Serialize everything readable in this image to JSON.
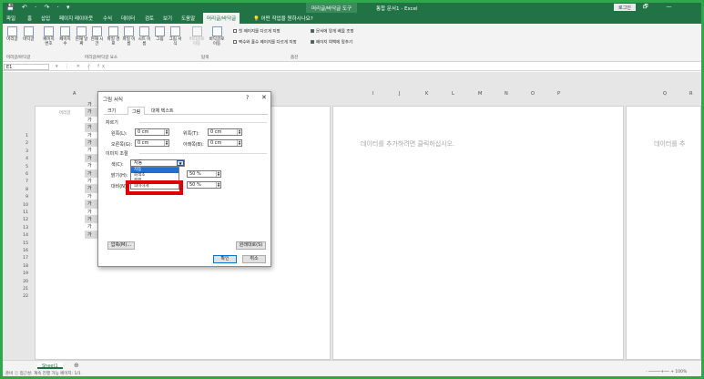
{
  "titlebar": {
    "quick_access": "💾 ↶ · ↷ · ▾",
    "context_tab": "머리글/바닥글 도구",
    "title": "통합 문서1 - Excel",
    "signin": "로그인",
    "window_buttons": "🗗 — ▢ ✕"
  },
  "tabs": [
    "파일",
    "홈",
    "삽입",
    "페이지 레이아웃",
    "수식",
    "데이터",
    "검토",
    "보기",
    "도움말",
    "머리글/바닥글"
  ],
  "tell_me": "💡 어떤 작업을 원하시나요?",
  "ribbon": {
    "buttons": [
      "머리글",
      "바닥글",
      "페이지 번호",
      "페이지 수",
      "현재 날짜",
      "현재 시간",
      "파일 경로",
      "파일 이름",
      "시트 이름",
      "그림",
      "그림 서식",
      "머리글로 이동",
      "바닥글로 이동"
    ],
    "groups": [
      "머리글/바닥글",
      "머리글/바닥글 요소",
      "탐색",
      "옵션"
    ],
    "options": [
      "첫 페이지를 다르게 지정",
      "짝수와 홀수 페이지를 다르게 지정",
      "문서에 맞게 배율 조정",
      "페이지 여백에 맞추기"
    ]
  },
  "formula_bar": {
    "namebox": "E1",
    "icons": "▾ ⋮ ✕ ✓ fx"
  },
  "sheet": {
    "columns_left": [
      "A",
      "B",
      "C",
      "D",
      "E",
      "F"
    ],
    "columns_right": [
      "I",
      "J",
      "K",
      "L",
      "M",
      "N",
      "O",
      "P"
    ],
    "columns_far": [
      "Q",
      "R"
    ],
    "rows": [
      "1",
      "2",
      "3",
      "4",
      "5",
      "6",
      "7",
      "8",
      "9",
      "10",
      "11",
      "12",
      "13",
      "14",
      "15",
      "16",
      "17",
      "18",
      "19",
      "20",
      "21",
      "22"
    ],
    "header_label": "머리글",
    "hint": "데이터를 추가하려면 클릭하십시오.",
    "hint_far": "데이터를 추",
    "row_values": [
      "가",
      "나",
      "다",
      "라",
      "마",
      "바"
    ],
    "left_only": "가"
  },
  "status": {
    "sheet_tab": "Sheet1",
    "add": "⊕",
    "text": "준비  ⓘ 접근성: 계속 진행 가능  페이지: 1/1",
    "zoom": "- ─────+── + 100%"
  },
  "dialog": {
    "title": "그림 서식",
    "help": "?",
    "close": "✕",
    "tabs": [
      "크기",
      "그림",
      "대체 텍스트"
    ],
    "crop_section": "자르기",
    "left_label": "왼쪽(L):",
    "right_label": "오른쪽(G):",
    "top_label": "위쪽(T):",
    "bottom_label": "아래쪽(B):",
    "left_val": "0 cm",
    "right_val": "0 cm",
    "top_val": "0 cm",
    "bottom_val": "0 cm",
    "image_section": "이미지 조절",
    "color_label": "색(C):",
    "color_value": "자동",
    "brightness_label": "밝기(H):",
    "contrast_label": "대비(N):",
    "brightness_val": "50 %",
    "contrast_val": "50 %",
    "dropdown_options": [
      "자동",
      "회색조",
      "흑백",
      "희미하게"
    ],
    "compress_button": "압축(M)...",
    "reset_button": "원래대로(S)",
    "ok_button": "확인",
    "cancel_button": "취소"
  },
  "colors": {
    "brand": "#217346",
    "highlight": "#e10000",
    "selected": "#1e6fcf"
  }
}
